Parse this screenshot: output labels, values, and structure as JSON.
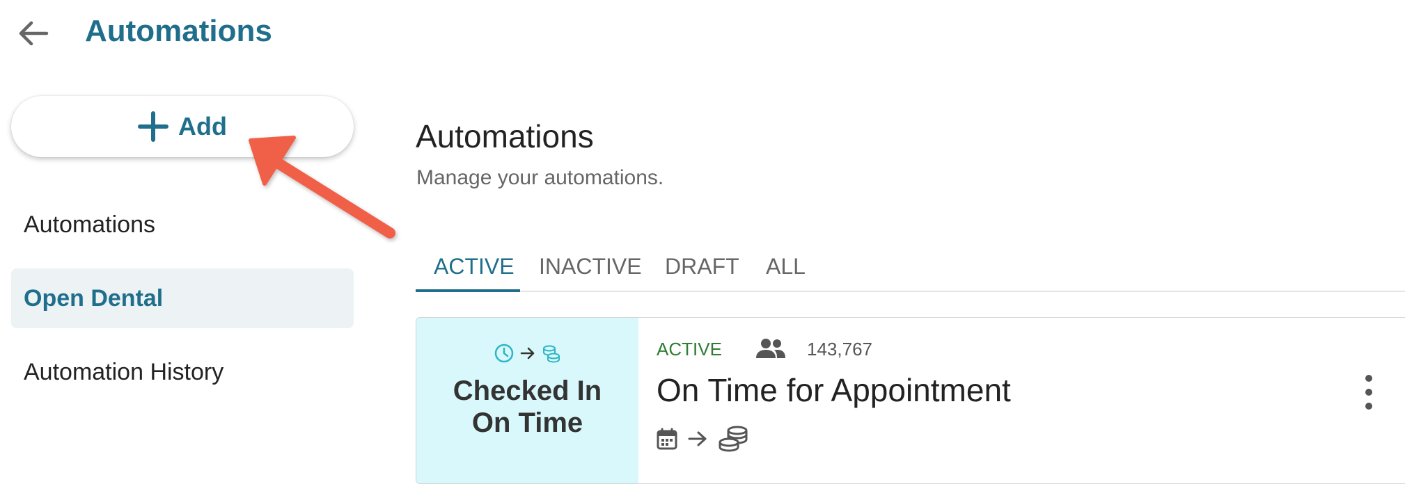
{
  "header": {
    "title": "Automations",
    "back_icon": "arrow-left-icon"
  },
  "sidebar": {
    "add_label": "Add",
    "items": [
      {
        "label": "Automations",
        "active": false
      },
      {
        "label": "Open Dental",
        "active": true
      },
      {
        "label": "Automation History",
        "active": false
      }
    ]
  },
  "main": {
    "title": "Automations",
    "subtitle": "Manage your automations.",
    "tabs": [
      {
        "label": "ACTIVE",
        "active": true
      },
      {
        "label": "INACTIVE",
        "active": false
      },
      {
        "label": "DRAFT",
        "active": false
      },
      {
        "label": "ALL",
        "active": false
      }
    ]
  },
  "card": {
    "thumbnail_line1": "Checked In",
    "thumbnail_line2": "On Time",
    "status": "ACTIVE",
    "count": "143,767",
    "title": "On Time for Appointment",
    "icons": [
      "clock-icon",
      "arrow-right-icon",
      "coins-icon",
      "calendar-icon",
      "people-icon",
      "more-vert-icon"
    ]
  },
  "colors": {
    "accent": "#1f6e8c",
    "active_status": "#2e7d32",
    "thumbnail_bg": "#d8f8fb",
    "selected_nav_bg": "#edf2f4",
    "annotation_arrow": "#f0604a"
  }
}
